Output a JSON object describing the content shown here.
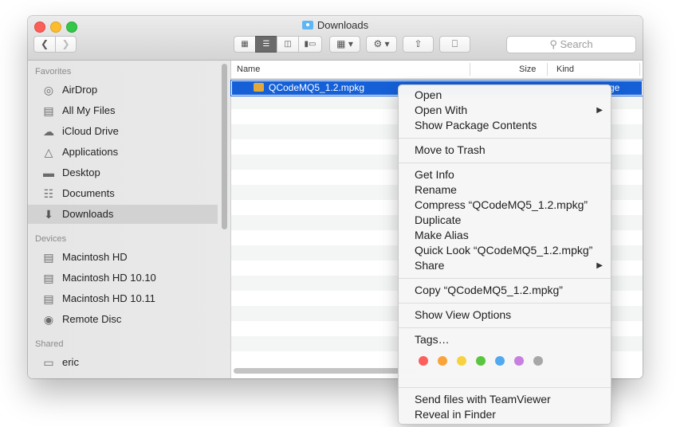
{
  "window": {
    "title": "Downloads"
  },
  "toolbar": {
    "search_placeholder": "Search"
  },
  "sidebar": {
    "favorites_heading": "Favorites",
    "favorites": [
      {
        "label": "AirDrop",
        "icon": "airdrop-icon"
      },
      {
        "label": "All My Files",
        "icon": "all-my-files-icon"
      },
      {
        "label": "iCloud Drive",
        "icon": "cloud-icon"
      },
      {
        "label": "Applications",
        "icon": "applications-icon"
      },
      {
        "label": "Desktop",
        "icon": "desktop-icon"
      },
      {
        "label": "Documents",
        "icon": "documents-icon"
      },
      {
        "label": "Downloads",
        "icon": "downloads-icon",
        "selected": true
      }
    ],
    "devices_heading": "Devices",
    "devices": [
      {
        "label": "Macintosh HD",
        "icon": "disk-icon"
      },
      {
        "label": "Macintosh HD 10.10",
        "icon": "disk-icon"
      },
      {
        "label": "Macintosh HD 10.11",
        "icon": "disk-icon"
      },
      {
        "label": "Remote Disc",
        "icon": "disc-icon"
      }
    ],
    "shared_heading": "Shared",
    "shared": [
      {
        "label": "eric",
        "icon": "computer-icon"
      }
    ]
  },
  "file_list": {
    "columns": {
      "name": "Name",
      "size": "Size",
      "kind": "Kind"
    },
    "rows": [
      {
        "name": "QCodeMQ5_1.2.mpkg",
        "kind_visible": "ge",
        "selected": true
      }
    ]
  },
  "context_menu": {
    "open": "Open",
    "open_with": "Open With",
    "show_package_contents": "Show Package Contents",
    "move_to_trash": "Move to Trash",
    "get_info": "Get Info",
    "rename": "Rename",
    "compress": "Compress “QCodeMQ5_1.2.mpkg”",
    "duplicate": "Duplicate",
    "make_alias": "Make Alias",
    "quick_look": "Quick Look “QCodeMQ5_1.2.mpkg”",
    "share": "Share",
    "copy": "Copy “QCodeMQ5_1.2.mpkg”",
    "show_view_options": "Show View Options",
    "tags": "Tags…",
    "tag_colors": [
      "#fc605c",
      "#f9a43a",
      "#f7d23e",
      "#5ac53f",
      "#51a9f0",
      "#c77fe0",
      "#a7a7a7"
    ],
    "send_teamviewer": "Send files with TeamViewer",
    "reveal_in_finder": "Reveal in Finder"
  }
}
